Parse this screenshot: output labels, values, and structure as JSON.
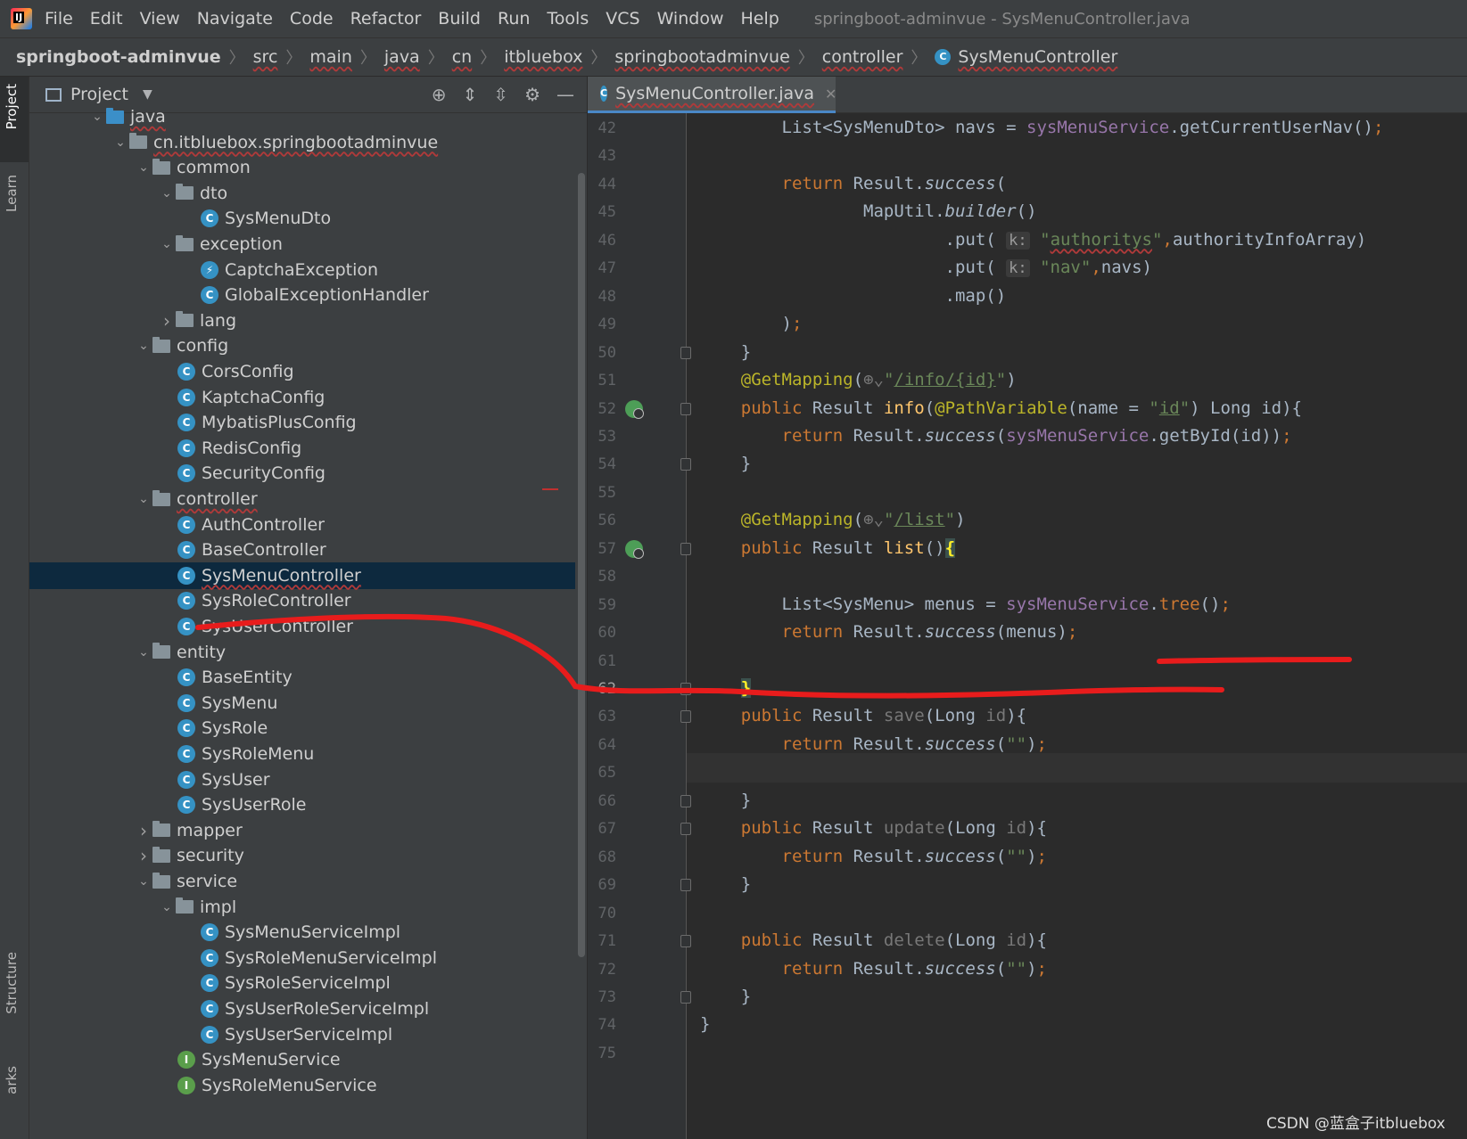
{
  "menu": [
    "File",
    "Edit",
    "View",
    "Navigate",
    "Code",
    "Refactor",
    "Build",
    "Run",
    "Tools",
    "VCS",
    "Window",
    "Help"
  ],
  "window_title": "springboot-adminvue - SysMenuController.java",
  "breadcrumbs": [
    "springboot-adminvue",
    "src",
    "main",
    "java",
    "cn",
    "itbluebox",
    "springbootadminvue",
    "controller",
    "SysMenuController"
  ],
  "left_tabs": {
    "project": "Project",
    "learn": "Learn",
    "structure": "Structure",
    "bookmarks": "arks"
  },
  "project_panel": {
    "title": "Project",
    "tree": [
      {
        "label": "java",
        "depth": 0,
        "type": "folder-blue",
        "open": true
      },
      {
        "label": "cn.itbluebox.springbootadminvue",
        "depth": 1,
        "type": "folder",
        "open": true
      },
      {
        "label": "common",
        "depth": 2,
        "type": "folder",
        "open": true
      },
      {
        "label": "dto",
        "depth": 3,
        "type": "folder",
        "open": true
      },
      {
        "label": "SysMenuDto",
        "depth": 4,
        "type": "class"
      },
      {
        "label": "exception",
        "depth": 3,
        "type": "folder",
        "open": true
      },
      {
        "label": "CaptchaException",
        "depth": 4,
        "type": "exception"
      },
      {
        "label": "GlobalExceptionHandler",
        "depth": 4,
        "type": "class"
      },
      {
        "label": "lang",
        "depth": 3,
        "type": "folder",
        "open": false
      },
      {
        "label": "config",
        "depth": 2,
        "type": "folder",
        "open": true
      },
      {
        "label": "CorsConfig",
        "depth": 3,
        "type": "class"
      },
      {
        "label": "KaptchaConfig",
        "depth": 3,
        "type": "class"
      },
      {
        "label": "MybatisPlusConfig",
        "depth": 3,
        "type": "class"
      },
      {
        "label": "RedisConfig",
        "depth": 3,
        "type": "class"
      },
      {
        "label": "SecurityConfig",
        "depth": 3,
        "type": "class"
      },
      {
        "label": "controller",
        "depth": 2,
        "type": "folder",
        "open": true
      },
      {
        "label": "AuthController",
        "depth": 3,
        "type": "class"
      },
      {
        "label": "BaseController",
        "depth": 3,
        "type": "class"
      },
      {
        "label": "SysMenuController",
        "depth": 3,
        "type": "class",
        "selected": true
      },
      {
        "label": "SysRoleController",
        "depth": 3,
        "type": "class"
      },
      {
        "label": "SysUserController",
        "depth": 3,
        "type": "class"
      },
      {
        "label": "entity",
        "depth": 2,
        "type": "folder",
        "open": true
      },
      {
        "label": "BaseEntity",
        "depth": 3,
        "type": "class"
      },
      {
        "label": "SysMenu",
        "depth": 3,
        "type": "class"
      },
      {
        "label": "SysRole",
        "depth": 3,
        "type": "class"
      },
      {
        "label": "SysRoleMenu",
        "depth": 3,
        "type": "class"
      },
      {
        "label": "SysUser",
        "depth": 3,
        "type": "class"
      },
      {
        "label": "SysUserRole",
        "depth": 3,
        "type": "class"
      },
      {
        "label": "mapper",
        "depth": 2,
        "type": "folder",
        "open": false
      },
      {
        "label": "security",
        "depth": 2,
        "type": "folder",
        "open": false
      },
      {
        "label": "service",
        "depth": 2,
        "type": "folder",
        "open": true
      },
      {
        "label": "impl",
        "depth": 3,
        "type": "folder",
        "open": true
      },
      {
        "label": "SysMenuServiceImpl",
        "depth": 4,
        "type": "class"
      },
      {
        "label": "SysRoleMenuServiceImpl",
        "depth": 4,
        "type": "class"
      },
      {
        "label": "SysRoleServiceImpl",
        "depth": 4,
        "type": "class"
      },
      {
        "label": "SysUserRoleServiceImpl",
        "depth": 4,
        "type": "class"
      },
      {
        "label": "SysUserServiceImpl",
        "depth": 4,
        "type": "class"
      },
      {
        "label": "SysMenuService",
        "depth": 3,
        "type": "interface"
      },
      {
        "label": "SysRoleMenuService",
        "depth": 3,
        "type": "interface"
      }
    ]
  },
  "editor": {
    "tab_label": "SysMenuController.java",
    "current_line": 62,
    "lines": [
      {
        "n": 42,
        "html": "        List&lt;SysMenuDto&gt; navs = <span class='fld'>sysMenuService</span>.getCurrentUserNav()<span class='kw'>;</span>"
      },
      {
        "n": 43,
        "html": ""
      },
      {
        "n": 44,
        "html": "        <span class='kw'>return</span> Result.<span class='it'>success</span>("
      },
      {
        "n": 45,
        "html": "                MapUtil.<span class='it'>builder</span>()"
      },
      {
        "n": 46,
        "html": "                        .put( <span class='ph'>k:</span> <span class='st'>\"<span class='wavy'>authoritys</span>\"</span><span class='kw'>,</span>authorityInfoArray)"
      },
      {
        "n": 47,
        "html": "                        .put( <span class='ph'>k:</span> <span class='st'>\"nav\"</span><span class='kw'>,</span>navs)"
      },
      {
        "n": 48,
        "html": "                        .map()"
      },
      {
        "n": 49,
        "html": "        )<span class='kw'>;</span>"
      },
      {
        "n": 50,
        "html": "    }"
      },
      {
        "n": 51,
        "html": "    <span class='an'>@GetMapping</span>(<span class='gr'>⊕⌄</span><span class='st'>\"<span class='ul'>/info/{id}</span>\"</span>)"
      },
      {
        "n": 52,
        "html": "    <span class='kw'>public</span> Result <span class='fn'>info</span>(<span class='an'>@PathVariable</span>(name = <span class='st'>\"<span class='ul'>id</span>\"</span>) Long id){"
      },
      {
        "n": 53,
        "html": "        <span class='kw'>return</span> Result.<span class='it'>success</span>(<span class='fld'>sysMenuService</span>.getById(id))<span class='kw'>;</span>"
      },
      {
        "n": 54,
        "html": "    }"
      },
      {
        "n": 55,
        "html": ""
      },
      {
        "n": 56,
        "html": "    <span class='an'>@GetMapping</span>(<span class='gr'>⊕⌄</span><span class='st'>\"<span class='ul'>/list</span>\"</span>)"
      },
      {
        "n": 57,
        "html": "    <span class='kw'>public</span> Result <span class='fn'>list</span>()<span class='brace-hl'>{</span>"
      },
      {
        "n": 58,
        "html": ""
      },
      {
        "n": 59,
        "html": "        List&lt;SysMenu&gt; menus = <span class='fld'>sysMenuService</span>.<span class='kw'>tree</span>()<span class='kw'>;</span>"
      },
      {
        "n": 60,
        "html": "        <span class='kw'>return</span> Result.<span class='it'>success</span>(menus)<span class='kw'>;</span>"
      },
      {
        "n": 61,
        "html": ""
      },
      {
        "n": 62,
        "html": "    <span class='brace-hl'>}</span>"
      },
      {
        "n": 63,
        "html": "    <span class='kw'>public</span> Result <span class='gr'>save</span>(Long <span class='gr'>id</span>){"
      },
      {
        "n": 64,
        "html": "        <span class='kw'>return</span> Result.<span class='it'>success</span>(<span class='st'>\"\"</span>)<span class='kw'>;</span>"
      },
      {
        "n": 65,
        "html": ""
      },
      {
        "n": 66,
        "html": "    }"
      },
      {
        "n": 67,
        "html": "    <span class='kw'>public</span> Result <span class='gr'>update</span>(Long <span class='gr'>id</span>){"
      },
      {
        "n": 68,
        "html": "        <span class='kw'>return</span> Result.<span class='it'>success</span>(<span class='st'>\"\"</span>)<span class='kw'>;</span>"
      },
      {
        "n": 69,
        "html": "    }"
      },
      {
        "n": 70,
        "html": ""
      },
      {
        "n": 71,
        "html": "    <span class='kw'>public</span> Result <span class='gr'>delete</span>(Long <span class='gr'>id</span>){"
      },
      {
        "n": 72,
        "html": "        <span class='kw'>return</span> Result.<span class='it'>success</span>(<span class='st'>\"\"</span>)<span class='kw'>;</span>"
      },
      {
        "n": 73,
        "html": "    }"
      },
      {
        "n": 74,
        "html": "}"
      },
      {
        "n": 75,
        "html": ""
      }
    ],
    "bean_lines": [
      52,
      57
    ],
    "fold_lines": [
      50,
      52,
      54,
      57,
      62,
      63,
      66,
      67,
      69,
      71,
      73
    ]
  },
  "watermark": "CSDN @蓝盒子itbluebox",
  "colors": {
    "annotation_stroke": "#e81c1c",
    "selection": "#0d293e",
    "class_icon": "#3592c4",
    "interface_icon": "#5a9e4b"
  }
}
